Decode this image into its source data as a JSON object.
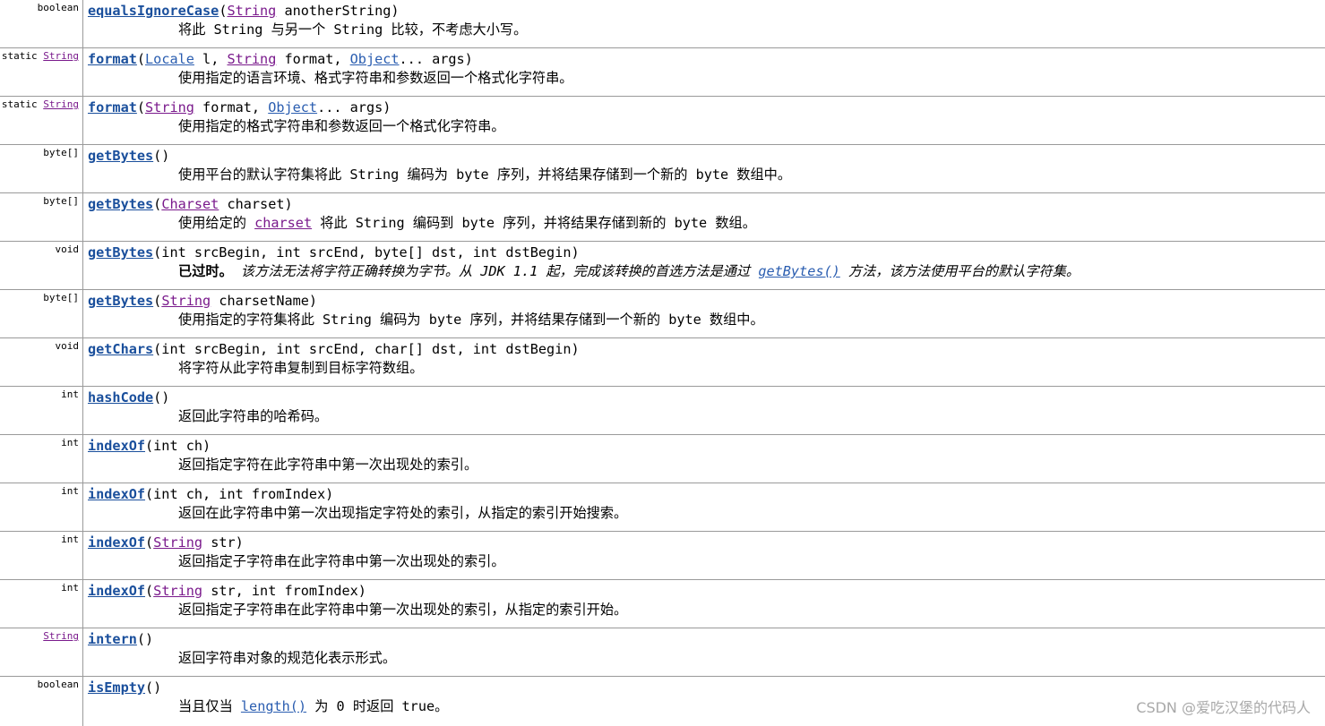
{
  "rows": [
    {
      "modifier": "boolean",
      "method": "equalsIgnoreCase",
      "open": "(",
      "p1_type": "String",
      "p1_rest": " anotherString)",
      "desc": "将此 String 与另一个 String 比较，不考虑大小写。"
    },
    {
      "mod_static": "static ",
      "mod_type": "String",
      "method": "format",
      "open": "(",
      "p1_type": "Locale",
      "p1_rest": " l, ",
      "p2_type": "String",
      "p2_rest": " format, ",
      "p3_type": "Object",
      "p3_rest": "... args)",
      "desc": "使用指定的语言环境、格式字符串和参数返回一个格式化字符串。"
    },
    {
      "mod_static": "static ",
      "mod_type": "String",
      "method": "format",
      "open": "(",
      "p1_type": "String",
      "p1_rest": " format, ",
      "p2_type": "Object",
      "p2_rest": "... args)",
      "desc": "使用指定的格式字符串和参数返回一个格式化字符串。"
    },
    {
      "modifier": "byte[]",
      "method": "getBytes",
      "params": "()",
      "desc": "使用平台的默认字符集将此 String 编码为 byte 序列，并将结果存储到一个新的 byte 数组中。"
    },
    {
      "modifier": "byte[]",
      "method": "getBytes",
      "open": "(",
      "p1_type": "Charset",
      "p1_rest": " charset)",
      "desc_a": "使用给定的 ",
      "desc_link": "charset",
      "desc_b": " 将此 String 编码到 byte 序列，并将结果存储到新的 byte 数组。"
    },
    {
      "modifier": "void",
      "method": "getBytes",
      "params": "(int srcBegin, int srcEnd, byte[] dst, int dstBegin)",
      "deprecated_label": "已过时。",
      "desc_a": " 该方法无法将字符正确转换为字节。从 JDK 1.1 起，完成该转换的首选方法是通过 ",
      "desc_link": "getBytes()",
      "desc_b": " 方法，该方法使用平台的默认字符集。"
    },
    {
      "modifier": "byte[]",
      "method": "getBytes",
      "open": "(",
      "p1_type": "String",
      "p1_rest": " charsetName)",
      "desc": "使用指定的字符集将此 String 编码为 byte 序列，并将结果存储到一个新的 byte 数组中。"
    },
    {
      "modifier": "void",
      "method": "getChars",
      "params": "(int srcBegin, int srcEnd, char[] dst, int dstBegin)",
      "desc": "将字符从此字符串复制到目标字符数组。"
    },
    {
      "modifier": "int",
      "method": "hashCode",
      "params": "()",
      "desc": "返回此字符串的哈希码。"
    },
    {
      "modifier": "int",
      "method": "indexOf",
      "params": "(int ch)",
      "desc": "返回指定字符在此字符串中第一次出现处的索引。"
    },
    {
      "modifier": "int",
      "method": "indexOf",
      "params": "(int ch, int fromIndex)",
      "desc": "返回在此字符串中第一次出现指定字符处的索引，从指定的索引开始搜索。"
    },
    {
      "modifier": "int",
      "method": "indexOf",
      "open": "(",
      "p1_type": "String",
      "p1_rest": " str)",
      "desc": "返回指定子字符串在此字符串中第一次出现处的索引。"
    },
    {
      "modifier": "int",
      "method": "indexOf",
      "open": "(",
      "p1_type": "String",
      "p1_rest": " str, int fromIndex)",
      "desc": "返回指定子字符串在此字符串中第一次出现处的索引，从指定的索引开始。"
    },
    {
      "mod_type": "String",
      "method": "intern",
      "params": "()",
      "desc": "返回字符串对象的规范化表示形式。"
    },
    {
      "modifier": "boolean",
      "method": "isEmpty",
      "params": "()",
      "desc_a": "当且仅当 ",
      "desc_link": "length()",
      "desc_b": " 为 0 时返回 true。"
    }
  ],
  "watermark": "CSDN @爱吃汉堡的代码人"
}
